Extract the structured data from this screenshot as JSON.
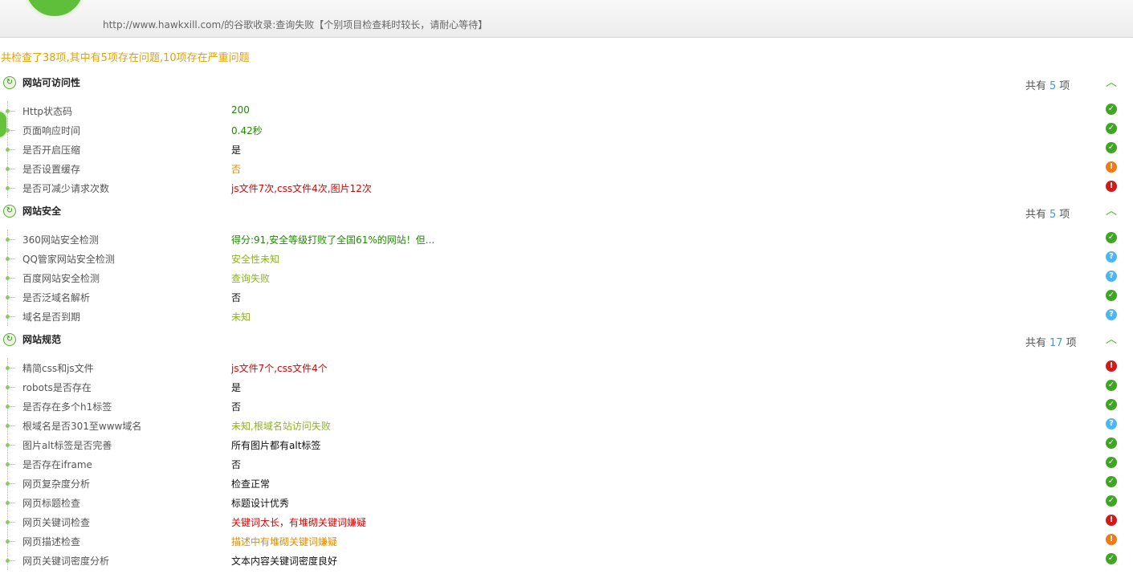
{
  "header": {
    "url_line": "http://www.hawkxill.com/的谷歌收录:查询失败【个别项目检查耗时较长，请耐心等待】"
  },
  "summary": "共检查了38项,其中有5项存在问题,10项存在严重问题",
  "count_prefix": "共有",
  "count_suffix": "项",
  "sections": [
    {
      "title": "网站可访问性",
      "count": "5",
      "rows": [
        {
          "name": "Http状态码",
          "value": "200",
          "color": "green",
          "status": "ok"
        },
        {
          "name": "页面响应时间",
          "value": "0.42秒",
          "color": "green",
          "status": "ok"
        },
        {
          "name": "是否开启压缩",
          "value": "是",
          "color": "black",
          "status": "ok"
        },
        {
          "name": "是否设置缓存",
          "value": "否",
          "color": "orange",
          "status": "warn"
        },
        {
          "name": "是否可减少请求次数",
          "value": "js文件7次,css文件4次,图片12次",
          "color": "red",
          "status": "err"
        }
      ]
    },
    {
      "title": "网站安全",
      "count": "5",
      "rows": [
        {
          "name": "360网站安全检测",
          "value": "得分:91,安全等级打败了全国61%的网站！但...",
          "color": "green",
          "status": "ok"
        },
        {
          "name": "QQ管家网站安全检测",
          "value": "安全性未知",
          "color": "lime",
          "status": "info"
        },
        {
          "name": "百度网站安全检测",
          "value": "查询失败",
          "color": "lime",
          "status": "info"
        },
        {
          "name": "是否泛域名解析",
          "value": "否",
          "color": "black",
          "status": "ok"
        },
        {
          "name": "域名是否到期",
          "value": "未知",
          "color": "lime",
          "status": "info"
        }
      ]
    },
    {
      "title": "网站规范",
      "count": "17",
      "rows": [
        {
          "name": "精简css和js文件",
          "value": "js文件7个,css文件4个",
          "color": "red",
          "status": "err"
        },
        {
          "name": "robots是否存在",
          "value": "是",
          "color": "black",
          "status": "ok"
        },
        {
          "name": "是否存在多个h1标签",
          "value": "否",
          "color": "black",
          "status": "ok"
        },
        {
          "name": "根域名是否301至www域名",
          "value": "未知,根域名站访问失败",
          "color": "lime",
          "status": "info"
        },
        {
          "name": "图片alt标签是否完善",
          "value": "所有图片都有alt标签",
          "color": "black",
          "status": "ok"
        },
        {
          "name": "是否存在iframe",
          "value": "否",
          "color": "black",
          "status": "ok"
        },
        {
          "name": "网页复杂度分析",
          "value": "检查正常",
          "color": "black",
          "status": "ok"
        },
        {
          "name": "网页标题检查",
          "value": "标题设计优秀",
          "color": "black",
          "status": "ok"
        },
        {
          "name": "网页关键词检查",
          "value": "关键词太长，有堆砌关键词嫌疑",
          "color": "red",
          "status": "err"
        },
        {
          "name": "网页描述检查",
          "value": "描述中有堆砌关键词嫌疑",
          "color": "orange",
          "status": "warn"
        },
        {
          "name": "网页关键词密度分析",
          "value": "文本内容关键词密度良好",
          "color": "black",
          "status": "ok"
        }
      ]
    }
  ],
  "icons": {
    "ok": "check-icon",
    "warn": "exclamation-icon",
    "err": "exclamation-icon",
    "info": "question-icon",
    "collapse": "chevron-up-icon",
    "section": "refresh-icon"
  }
}
